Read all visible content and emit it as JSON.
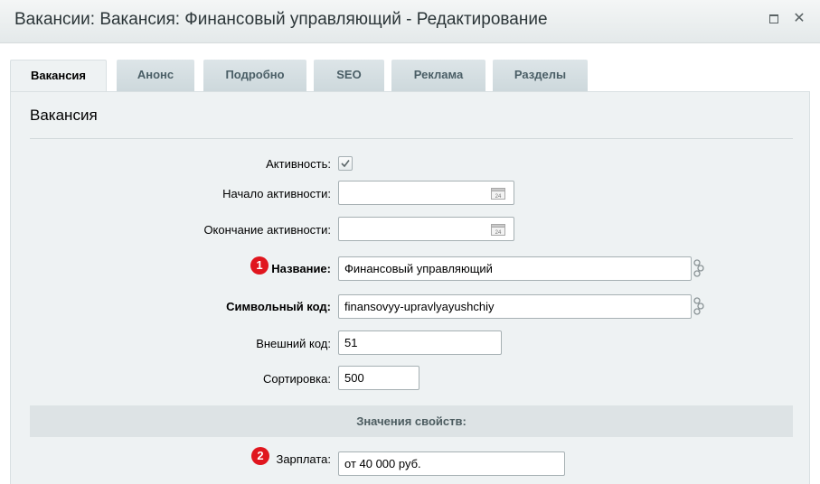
{
  "window": {
    "title": "Вакансии: Вакансия: Финансовый управляющий - Редактирование"
  },
  "tabs": [
    {
      "label": "Вакансия",
      "active": true
    },
    {
      "label": "Анонс"
    },
    {
      "label": "Подробно"
    },
    {
      "label": "SEO"
    },
    {
      "label": "Реклама"
    },
    {
      "label": "Разделы"
    }
  ],
  "section": {
    "title": "Вакансия"
  },
  "form": {
    "active_label": "Активность:",
    "active_checked": true,
    "start_label": "Начало активности:",
    "start_value": "",
    "end_label": "Окончание активности:",
    "end_value": "",
    "name_label": "Название:",
    "name_value": "Финансовый управляющий",
    "code_label": "Символьный код:",
    "code_value": "finansovyy-upravlyayushchiy",
    "external_label": "Внешний код:",
    "external_value": "51",
    "sort_label": "Сортировка:",
    "sort_value": "500"
  },
  "properties": {
    "header": "Значения свойств:",
    "salary_label": "Зарплата:",
    "salary_value": "от 40 000 руб."
  },
  "badges": {
    "first": "1",
    "second": "2"
  },
  "colors": {
    "badge": "#e0161e",
    "panel": "#eef2f3",
    "tab_inactive": "#d4dee1"
  }
}
